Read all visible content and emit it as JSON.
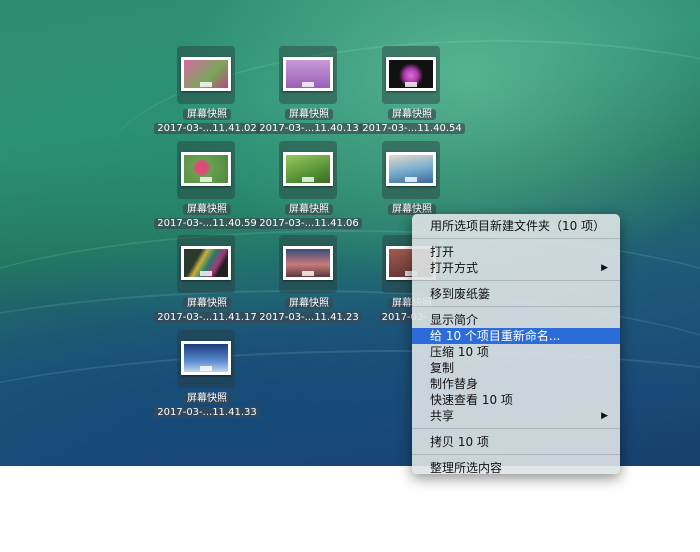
{
  "desktop": {
    "icons": [
      {
        "name": "屏幕快照",
        "date": "2017-03-...11.41.02"
      },
      {
        "name": "屏幕快照",
        "date": "2017-03-...11.40.13"
      },
      {
        "name": "屏幕快照",
        "date": "2017-03-...11.40.54"
      },
      {
        "name": "屏幕快照",
        "date": "2017-03-...11.40.59"
      },
      {
        "name": "屏幕快照",
        "date": "2017-03-...11.41.06"
      },
      {
        "name": "屏幕快照",
        "date": ""
      },
      {
        "name": "屏幕快照",
        "date": "2017-03-...11.41.17"
      },
      {
        "name": "屏幕快照",
        "date": "2017-03-...11.41.23"
      },
      {
        "name": "屏幕快照",
        "date": "2017-03-"
      },
      {
        "name": "屏幕快照",
        "date": "2017-03-...11.41.33"
      }
    ]
  },
  "context_menu": {
    "new_folder": "用所选项目新建文件夹（10 项）",
    "open": "打开",
    "open_with": "打开方式",
    "trash": "移到废纸篓",
    "get_info": "显示简介",
    "rename": "给 10 个项目重新命名...",
    "compress": "压缩 10 项",
    "duplicate": "复制",
    "alias": "制作替身",
    "quick_look": "快速查看 10 项",
    "share": "共享",
    "copy": "拷贝 10 项",
    "organize": "整理所选内容"
  }
}
